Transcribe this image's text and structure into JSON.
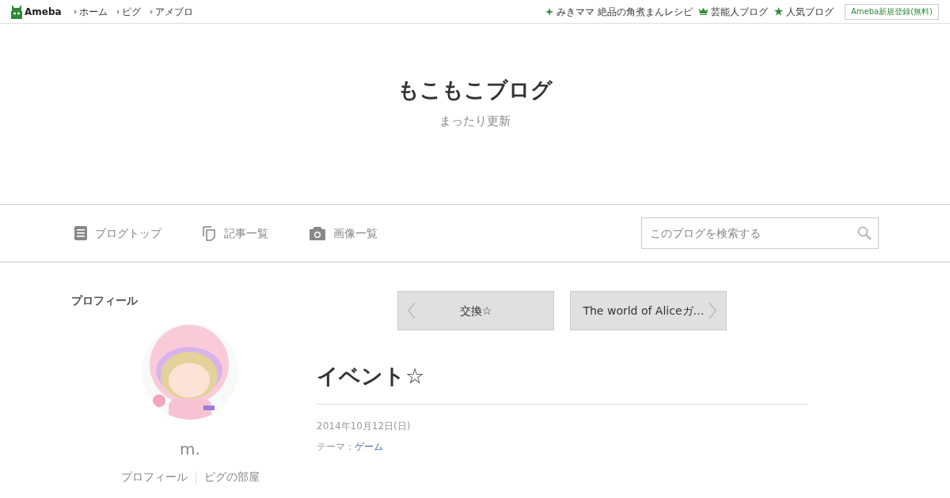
{
  "header": {
    "logo": "Ameba",
    "nav": [
      "ホーム",
      "ピグ",
      "アメブロ"
    ],
    "links": [
      {
        "kind": "sparkle",
        "label": "みきママ 絶品の角煮まんレシピ"
      },
      {
        "kind": "crown",
        "label": "芸能人ブログ"
      },
      {
        "kind": "star",
        "label": "人気ブログ"
      }
    ],
    "signup": "Ameba新規登録(無料)"
  },
  "blog": {
    "title": "もこもこブログ",
    "subtitle": "まったり更新"
  },
  "menu": [
    {
      "kind": "document",
      "label": "ブログトップ"
    },
    {
      "kind": "pages",
      "label": "記事一覧"
    },
    {
      "kind": "camera",
      "label": "画像一覧"
    }
  ],
  "search": {
    "placeholder": "このブログを検索する"
  },
  "profile": {
    "heading": "プロフィール",
    "avatar": {
      "kind": "picture"
    },
    "name": "m.",
    "links": [
      "プロフィール",
      "ピグの部屋"
    ]
  },
  "pager": {
    "prev": "交換☆",
    "next": "The world of Aliceガ…"
  },
  "entry": {
    "title": "イベント☆",
    "date": "2014年10月12日(日)",
    "theme_label": "テーマ：",
    "theme": "ゲーム"
  }
}
